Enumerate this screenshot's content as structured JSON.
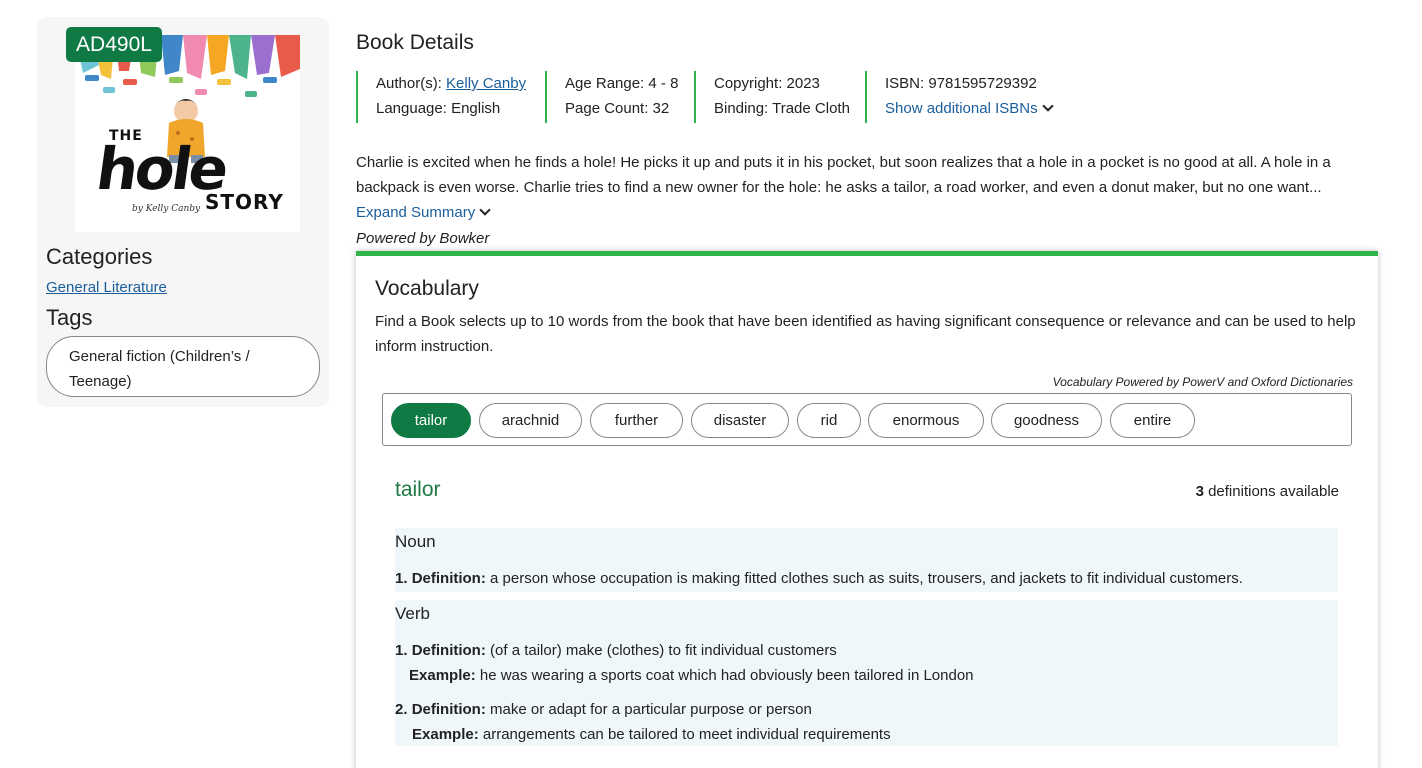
{
  "cover": {
    "badge": "AD490L",
    "title_the": "THE",
    "title_hole": "hole",
    "title_story": "STORY",
    "byline": "by Kelly Canby"
  },
  "categories": {
    "heading": "Categories",
    "items": [
      "General Literature"
    ]
  },
  "tags": {
    "heading": "Tags",
    "items": [
      "General fiction (Children’s / Teenage)"
    ]
  },
  "book_details": {
    "title": "Book Details",
    "author_label": "Author(s):",
    "author_value": "Kelly Canby",
    "language": "Language: English",
    "age_range": "Age Range: 4 - 8",
    "page_count": "Page Count: 32",
    "copyright": "Copyright: 2023",
    "binding": "Binding: Trade Cloth",
    "isbn": "ISBN: 9781595729392",
    "show_isbns": "Show additional ISBNs",
    "summary": "Charlie is excited when he finds a hole! He picks it up and puts it in his pocket, but soon realizes that a hole in a pocket is no good at all. A hole in a backpack is even worse. Charlie tries to find a new owner for the hole: he asks a tailor, a road worker, and even a donut maker, but no one want...",
    "expand_summary": "Expand Summary",
    "powered_by": "Powered by Bowker"
  },
  "vocabulary": {
    "title": "Vocabulary",
    "description": "Find a Book selects up to 10 words from the book that have been identified as having significant consequence or relevance and can be used to help inform instruction.",
    "powered_by": "Vocabulary Powered by PowerV and Oxford Dictionaries",
    "words": [
      "tailor",
      "arachnid",
      "further",
      "disaster",
      "rid",
      "enormous",
      "goodness",
      "entire"
    ],
    "selected_word": "tailor",
    "def_count": "3",
    "def_count_suffix": "definitions available",
    "noun": {
      "label": "Noun",
      "defs": [
        {
          "num": "1.",
          "def_label": "Definition:",
          "def": "a person whose occupation is making fitted clothes such as suits, trousers, and jackets to fit individual customers."
        }
      ]
    },
    "verb": {
      "label": "Verb",
      "defs": [
        {
          "num": "1.",
          "def_label": "Definition:",
          "def": "(of a tailor) make (clothes) to fit individual customers",
          "ex_label": "Example:",
          "example": "he was wearing a sports coat which had obviously been tailored in London"
        },
        {
          "num": "2.",
          "def_label": "Definition:",
          "def": "make or adapt for a particular purpose or person",
          "ex_label": "Example:",
          "example": "arrangements can be tailored to meet individual requirements"
        }
      ]
    }
  },
  "colors": {
    "brand_green": "#0f7a44",
    "accent_green": "#2fb34a",
    "link_blue": "#1a5e9c",
    "def_background": "#f0f7fb"
  }
}
